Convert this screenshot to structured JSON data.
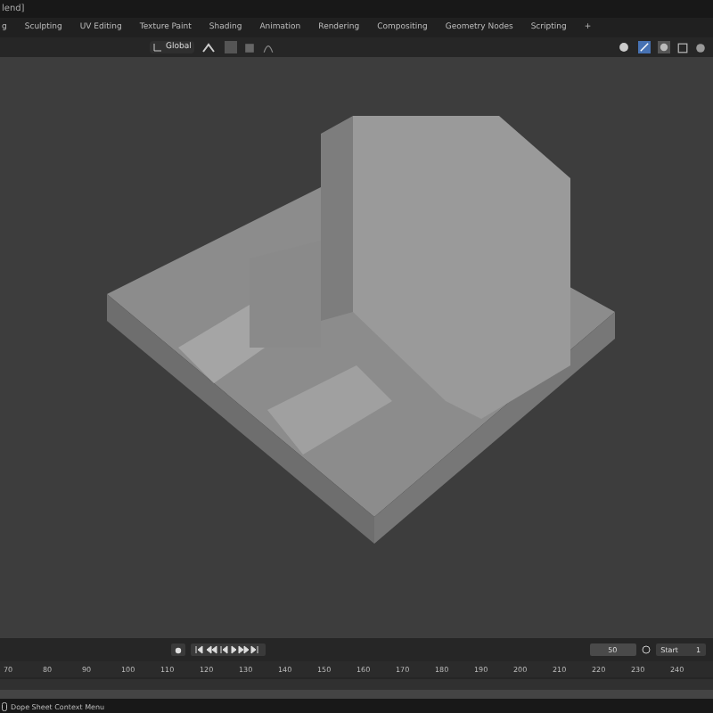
{
  "window": {
    "title": "lend]"
  },
  "workspace_tabs": [
    {
      "label": "g",
      "selected": false
    },
    {
      "label": "Sculpting",
      "selected": false
    },
    {
      "label": "UV Editing",
      "selected": false
    },
    {
      "label": "Texture Paint",
      "selected": false
    },
    {
      "label": "Shading",
      "selected": false
    },
    {
      "label": "Animation",
      "selected": false
    },
    {
      "label": "Rendering",
      "selected": false
    },
    {
      "label": "Compositing",
      "selected": false
    },
    {
      "label": "Geometry Nodes",
      "selected": false
    },
    {
      "label": "Scripting",
      "selected": false
    }
  ],
  "add_tab": "+",
  "viewport_header": {
    "orientation": "Global"
  },
  "timeline": {
    "current_frame": "50",
    "start_label": "Start",
    "start_value": "1",
    "ruler": [
      "70",
      "80",
      "90",
      "100",
      "110",
      "120",
      "130",
      "140",
      "150",
      "160",
      "170",
      "180",
      "190",
      "200",
      "210",
      "220",
      "230",
      "240"
    ]
  },
  "status_bar": {
    "text": "Dope Sheet Context Menu"
  }
}
